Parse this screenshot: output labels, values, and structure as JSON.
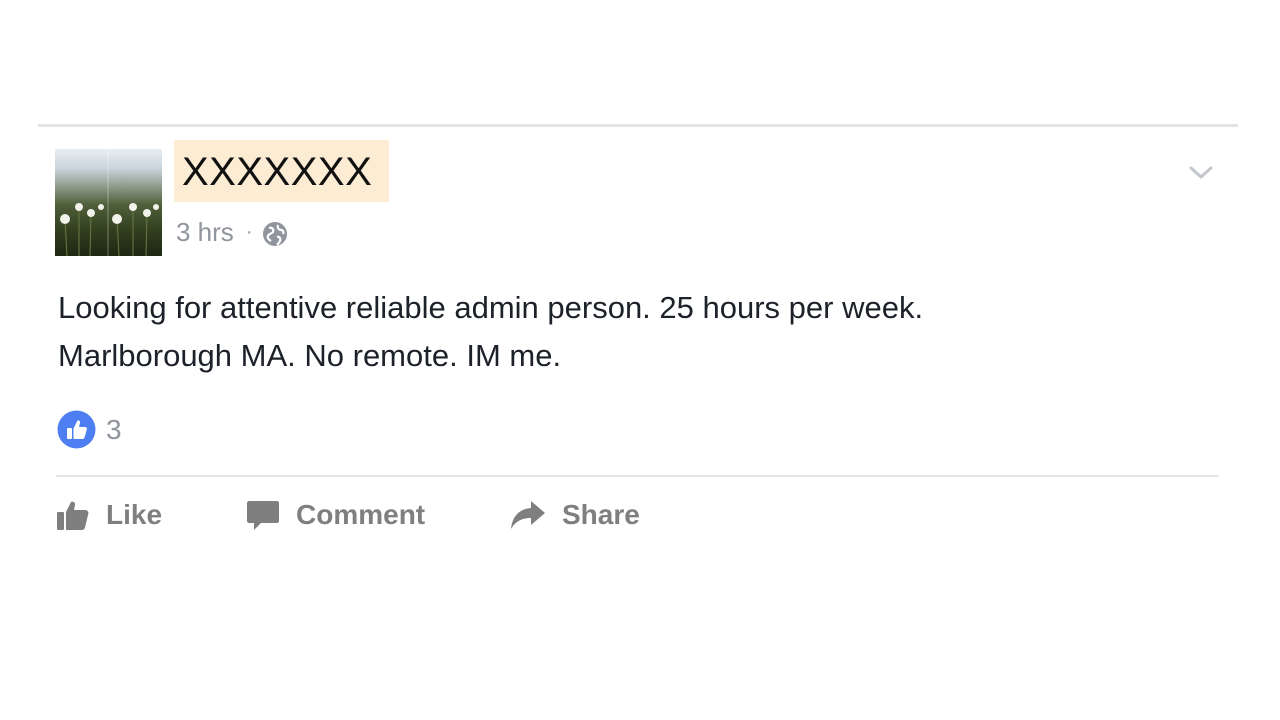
{
  "post": {
    "author": "XXXXXXX",
    "time": "3 hrs",
    "separator": "·",
    "privacy_icon": "globe-icon",
    "text_line1": "Looking for attentive reliable admin person. 25 hours per week.",
    "text_line2": "Marlborough MA. No remote. IM me.",
    "reactions": {
      "icon": "thumbs-up-icon",
      "count": "3"
    }
  },
  "actions": {
    "like": "Like",
    "comment": "Comment",
    "share": "Share"
  },
  "colors": {
    "name_highlight": "#fcecd3",
    "like_blue": "#4e7ff2",
    "muted_text": "#90949c",
    "action_gray": "#7f7f7f"
  }
}
